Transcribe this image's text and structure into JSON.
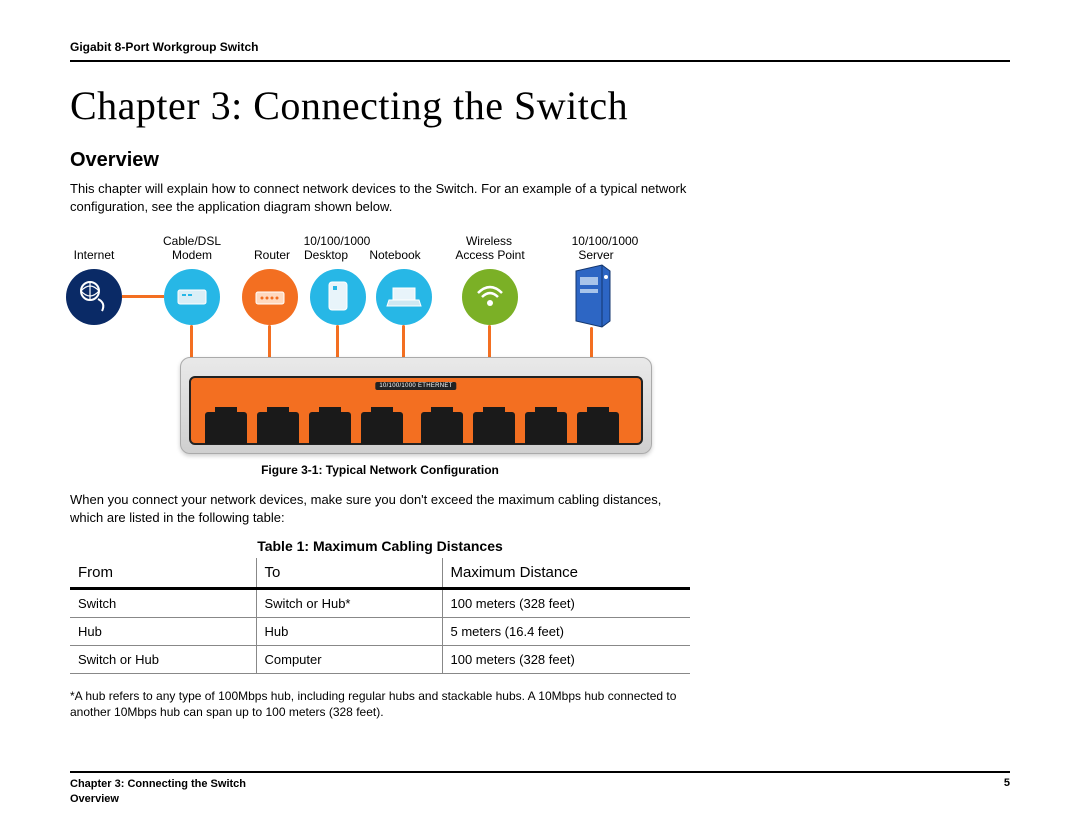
{
  "header": {
    "product": "Gigabit 8-Port Workgroup Switch"
  },
  "chapter": {
    "title": "Chapter 3: Connecting the Switch"
  },
  "overview": {
    "heading": "Overview",
    "intro": "This chapter will explain how to connect network devices to the Switch. For an example of a typical network configuration, see the application diagram shown below."
  },
  "diagram": {
    "devices": {
      "internet": {
        "label": "Internet"
      },
      "modem": {
        "label_top": "Cable/DSL",
        "label_bottom": "Modem"
      },
      "router": {
        "label": "Router"
      },
      "desktop": {
        "label_top": "10/100/1000",
        "label_bottom": "Desktop"
      },
      "notebook": {
        "label": "Notebook"
      },
      "ap": {
        "label_top": "Wireless",
        "label_bottom": "Access Point"
      },
      "server": {
        "label_top": "10/100/1000",
        "label_bottom": "Server"
      }
    },
    "switch_strip": "10/100/1000 ETHERNET",
    "caption": "Figure 3-1: Typical Network Configuration"
  },
  "post_figure_text": "When you connect your network devices, make sure you don't exceed the maximum cabling distances, which are listed in the following table:",
  "table": {
    "caption": "Table 1: Maximum Cabling Distances",
    "headers": {
      "from": "From",
      "to": "To",
      "dist": "Maximum Distance"
    },
    "rows": [
      {
        "from": "Switch",
        "to": "Switch or Hub*",
        "dist": "100 meters (328 feet)"
      },
      {
        "from": "Hub",
        "to": "Hub",
        "dist": "5 meters (16.4 feet)"
      },
      {
        "from": "Switch or Hub",
        "to": "Computer",
        "dist": "100 meters (328 feet)"
      }
    ],
    "footnote": "*A hub refers to any type of 100Mbps hub, including regular hubs and stackable hubs. A 10Mbps hub connected to another 10Mbps hub can span up to 100 meters (328 feet)."
  },
  "footer": {
    "left_line1": "Chapter 3: Connecting the Switch",
    "left_line2": "Overview",
    "page": "5"
  }
}
